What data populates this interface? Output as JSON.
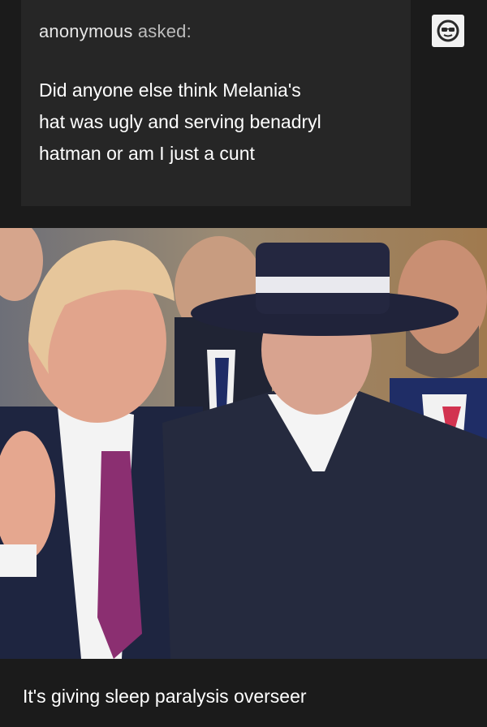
{
  "ask": {
    "asker_name": "anonymous",
    "asked_label": "asked:",
    "question": "Did anyone else think Melania's\nhat was ugly and serving benadryl\nhatman or am I just a cunt"
  },
  "avatar": {
    "icon": "sunglasses-face-icon"
  },
  "answer": {
    "text": "It's giving sleep paralysis overseer"
  }
}
